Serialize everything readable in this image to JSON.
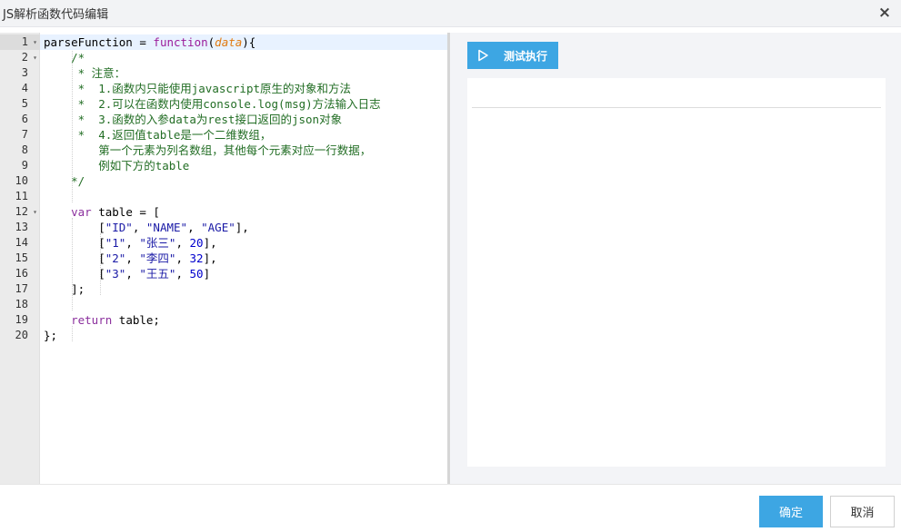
{
  "dialog": {
    "title": "JS解析函数代码编辑",
    "close_glyph": "×"
  },
  "editor": {
    "lines": [
      {
        "n": "1",
        "fold": true,
        "tokens": [
          {
            "t": "parseFunction",
            "c": "tok-plain"
          },
          {
            "t": " = ",
            "c": "tok-plain"
          },
          {
            "t": "function",
            "c": "tok-fn"
          },
          {
            "t": "(",
            "c": "tok-plain"
          },
          {
            "t": "data",
            "c": "tok-param"
          },
          {
            "t": "){",
            "c": "tok-plain"
          }
        ]
      },
      {
        "n": "2",
        "fold": true,
        "tokens": [
          {
            "t": "    /*",
            "c": "tok-cmt"
          }
        ]
      },
      {
        "n": "3",
        "fold": false,
        "tokens": [
          {
            "t": "     * 注意：",
            "c": "tok-cmt"
          }
        ]
      },
      {
        "n": "4",
        "fold": false,
        "tokens": [
          {
            "t": "     *  1.函数内只能使用javascript原生的对象和方法",
            "c": "tok-cmt"
          }
        ]
      },
      {
        "n": "5",
        "fold": false,
        "tokens": [
          {
            "t": "     *  2.可以在函数内使用console.log(msg)方法输入日志",
            "c": "tok-cmt"
          }
        ]
      },
      {
        "n": "6",
        "fold": false,
        "tokens": [
          {
            "t": "     *  3.函数的入参data为rest接口返回的json对象",
            "c": "tok-cmt"
          }
        ]
      },
      {
        "n": "7",
        "fold": false,
        "tokens": [
          {
            "t": "     *  4.返回值table是一个二维数组，",
            "c": "tok-cmt"
          }
        ]
      },
      {
        "n": "8",
        "fold": false,
        "tokens": [
          {
            "t": "        第一个元素为列名数组，其他每个元素对应一行数据，",
            "c": "tok-cmt"
          }
        ]
      },
      {
        "n": "9",
        "fold": false,
        "tokens": [
          {
            "t": "        例如下方的table",
            "c": "tok-cmt"
          }
        ]
      },
      {
        "n": "10",
        "fold": false,
        "tokens": [
          {
            "t": "    */",
            "c": "tok-cmt"
          }
        ]
      },
      {
        "n": "11",
        "fold": false,
        "tokens": []
      },
      {
        "n": "12",
        "fold": true,
        "tokens": [
          {
            "t": "    ",
            "c": "tok-plain"
          },
          {
            "t": "var",
            "c": "tok-kw"
          },
          {
            "t": " table = [",
            "c": "tok-plain"
          }
        ]
      },
      {
        "n": "13",
        "fold": false,
        "tokens": [
          {
            "t": "        [",
            "c": "tok-plain"
          },
          {
            "t": "\"ID\"",
            "c": "tok-str"
          },
          {
            "t": ", ",
            "c": "tok-plain"
          },
          {
            "t": "\"NAME\"",
            "c": "tok-str"
          },
          {
            "t": ", ",
            "c": "tok-plain"
          },
          {
            "t": "\"AGE\"",
            "c": "tok-str"
          },
          {
            "t": "],",
            "c": "tok-plain"
          }
        ]
      },
      {
        "n": "14",
        "fold": false,
        "tokens": [
          {
            "t": "        [",
            "c": "tok-plain"
          },
          {
            "t": "\"1\"",
            "c": "tok-str"
          },
          {
            "t": ", ",
            "c": "tok-plain"
          },
          {
            "t": "\"张三\"",
            "c": "tok-str"
          },
          {
            "t": ", ",
            "c": "tok-plain"
          },
          {
            "t": "20",
            "c": "tok-num"
          },
          {
            "t": "],",
            "c": "tok-plain"
          }
        ]
      },
      {
        "n": "15",
        "fold": false,
        "tokens": [
          {
            "t": "        [",
            "c": "tok-plain"
          },
          {
            "t": "\"2\"",
            "c": "tok-str"
          },
          {
            "t": ", ",
            "c": "tok-plain"
          },
          {
            "t": "\"李四\"",
            "c": "tok-str"
          },
          {
            "t": ", ",
            "c": "tok-plain"
          },
          {
            "t": "32",
            "c": "tok-num"
          },
          {
            "t": "],",
            "c": "tok-plain"
          }
        ]
      },
      {
        "n": "16",
        "fold": false,
        "tokens": [
          {
            "t": "        [",
            "c": "tok-plain"
          },
          {
            "t": "\"3\"",
            "c": "tok-str"
          },
          {
            "t": ", ",
            "c": "tok-plain"
          },
          {
            "t": "\"王五\"",
            "c": "tok-str"
          },
          {
            "t": ", ",
            "c": "tok-plain"
          },
          {
            "t": "50",
            "c": "tok-num"
          },
          {
            "t": "]",
            "c": "tok-plain"
          }
        ]
      },
      {
        "n": "17",
        "fold": false,
        "tokens": [
          {
            "t": "    ];",
            "c": "tok-plain"
          }
        ]
      },
      {
        "n": "18",
        "fold": false,
        "tokens": []
      },
      {
        "n": "19",
        "fold": false,
        "tokens": [
          {
            "t": "    ",
            "c": "tok-plain"
          },
          {
            "t": "return",
            "c": "tok-kw"
          },
          {
            "t": " table;",
            "c": "tok-plain"
          }
        ]
      },
      {
        "n": "20",
        "fold": false,
        "tokens": [
          {
            "t": "};",
            "c": "tok-plain"
          }
        ]
      }
    ]
  },
  "run_panel": {
    "run_label": "测试执行",
    "run_icon": "play-icon"
  },
  "footer": {
    "ok_label": "确定",
    "cancel_label": "取消"
  },
  "colors": {
    "accent": "#3da6e3",
    "comment": "#236e25",
    "keyword": "#8b2f9d",
    "string": "#1a1aa6",
    "number": "#0000cd",
    "param": "#e07a10"
  }
}
